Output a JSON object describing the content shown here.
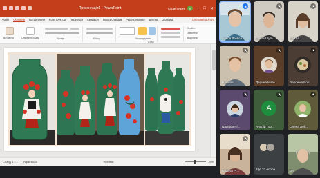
{
  "ppt": {
    "window_title": "Презентація1 - PowerPoint",
    "user_name": "Користувач",
    "user_initials": "К",
    "window_buttons": [
      "–",
      "□",
      "✕"
    ],
    "menu": [
      "Файл",
      "Основне",
      "Вставлення",
      "Конструктор",
      "Переходи",
      "Анімація",
      "Показ слайдів",
      "Рецензування",
      "Вигляд",
      "Довідка"
    ],
    "share_label": "Спільний доступ",
    "ribbon_labels": [
      "Вставити",
      "Створити слайд",
      "Шрифт",
      "Абзац",
      "Упорядкувати",
      "Стилі",
      "Знайти",
      "Замінити",
      "Виділити"
    ],
    "status": {
      "slide_info": "Слайд 1 з 1",
      "language": "Українська",
      "notes": "Нотатки",
      "zoom": "76%"
    }
  },
  "participants": [
    {
      "name": "Алеся Резвєв...",
      "speaking": true
    },
    {
      "name": "Ольга Шуль",
      "speaking": false
    },
    {
      "name": "Світла...",
      "speaking": false
    },
    {
      "name": "Наталія...",
      "speaking": false
    },
    {
      "name": "Дарина Маге...",
      "speaking": false
    },
    {
      "name": "Вероніка Вол...",
      "speaking": false
    },
    {
      "name": "Nadejda Pl...",
      "speaking": false
    },
    {
      "name": "Андрій Гор...",
      "speaking": false,
      "initial": "A"
    },
    {
      "name": "Олена Лоб...",
      "speaking": false
    },
    {
      "name": "nataliya Pl...",
      "speaking": false
    },
    {
      "name": "Ще 21 особа",
      "speaking": false
    },
    {
      "name": "Ви",
      "speaking": false
    }
  ],
  "colors": {
    "ppt_accent": "#c43e1c",
    "meet_blue": "#1a73e8",
    "avatar_green": "#1e8e3e"
  }
}
